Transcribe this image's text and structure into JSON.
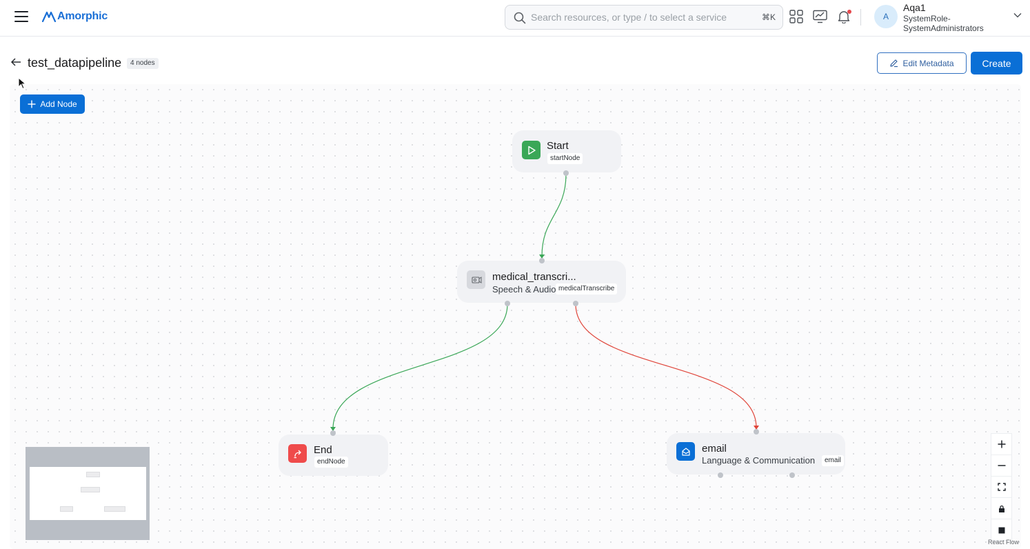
{
  "header": {
    "logo_text": "Amorphic",
    "search_placeholder": "Search resources, or type / to select a service",
    "search_shortcut": "⌘K",
    "user": {
      "initial": "A",
      "name": "Aqa1",
      "role": "SystemRole-SystemAdministrators"
    },
    "icons": [
      "menu-icon",
      "grid-icon",
      "monitor-chart-icon",
      "bell-icon",
      "chevron-down-icon"
    ]
  },
  "page": {
    "title": "test_datapipeline",
    "node_count": "4 nodes",
    "edit_metadata_label": "Edit Metadata",
    "create_label": "Create",
    "add_node_label": "Add Node"
  },
  "nodes": {
    "start": {
      "title": "Start",
      "tag": "startNode",
      "color": "#3aa757"
    },
    "medical": {
      "title": "medical_transcri...",
      "subtitle": "Speech & Audio",
      "tag": "medicalTranscribe",
      "color": "#d7d9de"
    },
    "end": {
      "title": "End",
      "tag": "endNode",
      "color": "#ef4b4b"
    },
    "email": {
      "title": "email",
      "subtitle": "Language & Communication",
      "tag": "email",
      "color": "#0a6fd6"
    }
  },
  "edges": [
    {
      "from": "start",
      "to": "medical",
      "color": "#3aa757"
    },
    {
      "from": "medical",
      "to": "end",
      "color": "#3aa757"
    },
    {
      "from": "medical",
      "to": "email",
      "color": "#e0453a"
    }
  ],
  "controls": [
    "zoom-in-icon",
    "zoom-out-icon",
    "fit-view-icon",
    "lock-icon",
    "stop-icon"
  ],
  "attribution": "React Flow"
}
